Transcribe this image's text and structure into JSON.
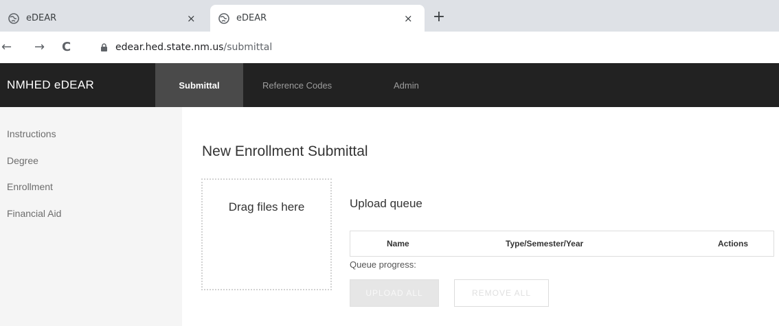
{
  "browser": {
    "tabs": [
      {
        "title": "eDEAR",
        "close": "×"
      },
      {
        "title": "eDEAR",
        "close": "×"
      }
    ],
    "new_tab": "+",
    "nav": {
      "back": "←",
      "forward": "→",
      "reload": "C"
    },
    "url_host": "edear.hed.state.nm.us",
    "url_path": "/submittal"
  },
  "navbar": {
    "brand": "NMHED eDEAR",
    "items": [
      {
        "label": "Submittal",
        "active": true
      },
      {
        "label": "Reference Codes",
        "active": false
      },
      {
        "label": "Admin",
        "active": false
      }
    ]
  },
  "sidebar": {
    "items": [
      {
        "label": "Instructions"
      },
      {
        "label": "Degree"
      },
      {
        "label": "Enrollment"
      },
      {
        "label": "Financial Aid"
      }
    ]
  },
  "main": {
    "title": "New Enrollment Submittal",
    "dropzone_text": "Drag files here",
    "queue_title": "Upload queue",
    "table_headers": [
      "Name",
      "Type/Semester/Year",
      "Actions"
    ],
    "progress_label": "Queue progress:",
    "upload_all": "UPLOAD ALL",
    "remove_all": "REMOVE ALL"
  }
}
